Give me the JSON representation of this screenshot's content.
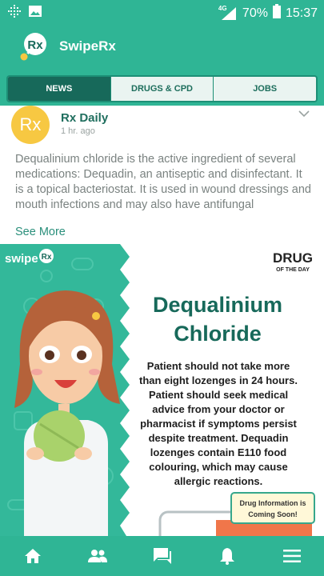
{
  "status_bar": {
    "network": "4G",
    "battery": "70%",
    "time": "15:37"
  },
  "app": {
    "title": "SwipeRx",
    "logo_text": "Rx"
  },
  "tabs": [
    {
      "label": "NEWS",
      "active": true
    },
    {
      "label": "DRUGS & CPD",
      "active": false
    },
    {
      "label": "JOBS",
      "active": false
    }
  ],
  "post": {
    "source": "Rx Daily",
    "time": "1 hr. ago",
    "avatar_text": "Rx",
    "text": "Dequalinium chloride is the active ingredient of several medications: Dequadin, an antiseptic and disinfectant. It is a topical bacteriostat. It is used in wound dressings and mouth infections and may also have antifungal",
    "see_more": "See More"
  },
  "image": {
    "brand": "swipe",
    "brand_badge": "Rx",
    "badge_title": "DRUG",
    "badge_subtitle": "OF THE DAY",
    "heading_line1": "Dequalinium",
    "heading_line2": "Chloride",
    "body_lines": [
      "Patient should not take more",
      "than eight lozenges in 24 hours.",
      "Patient should seek medical",
      "advice from your doctor or",
      "pharmacist if symptoms persist",
      "despite treatment. Dequadin",
      "lozenges contain E110 food",
      "colouring, which may cause",
      "allergic reactions."
    ],
    "note_line1": "Drug Information is",
    "note_line2": "Coming Soon!"
  },
  "nav": [
    "home-icon",
    "people-icon",
    "chat-icon",
    "bell-icon",
    "menu-icon"
  ],
  "colors": {
    "primary": "#2fb595",
    "dark_teal": "#17695a",
    "accent_yellow": "#f7c842"
  }
}
